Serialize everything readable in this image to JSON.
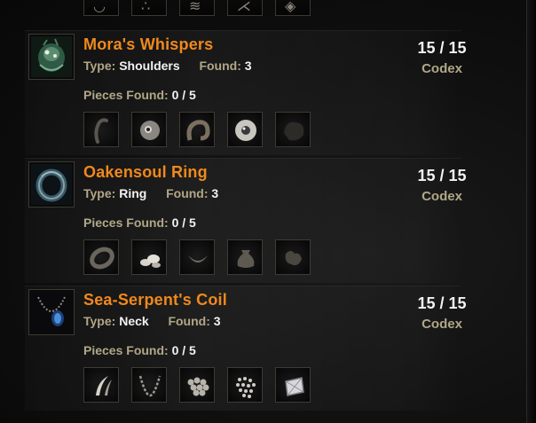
{
  "sets": [
    {
      "name": "Mora's Whispers",
      "type_label": "Type:",
      "type_value": "Shoulders",
      "found_label": "Found:",
      "found_value": "3",
      "pieces_label": "Pieces Found:",
      "pieces_value": "0 / 5",
      "count": "15 / 15",
      "codex": "Codex",
      "icon": "shoulder-armor-icon",
      "pieces": [
        "tentacle-icon",
        "eyeball-icon",
        "coiled-tentacle-icon",
        "eye-icon",
        "dark-cloth-icon"
      ]
    },
    {
      "name": "Oakensoul Ring",
      "type_label": "Type:",
      "type_value": "Ring",
      "found_label": "Found:",
      "found_value": "3",
      "pieces_label": "Pieces Found:",
      "pieces_value": "0 / 5",
      "count": "15 / 15",
      "codex": "Codex",
      "icon": "ring-icon",
      "pieces": [
        "ring-band-icon",
        "gem-shards-icon",
        "twisted-band-icon",
        "pouch-icon",
        "cloth-scrap-icon"
      ]
    },
    {
      "name": "Sea-Serpent's Coil",
      "type_label": "Type:",
      "type_value": "Neck",
      "found_label": "Found:",
      "found_value": "3",
      "pieces_label": "Pieces Found:",
      "pieces_value": "0 / 5",
      "count": "15 / 15",
      "codex": "Codex",
      "icon": "amulet-icon",
      "pieces": [
        "fang-icon",
        "chain-icon",
        "pearls-icon",
        "beads-icon",
        "gemstone-icon"
      ]
    }
  ]
}
